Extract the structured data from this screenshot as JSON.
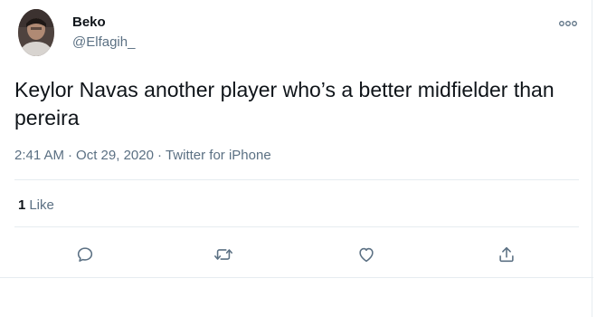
{
  "tweet": {
    "author": {
      "name": "Beko",
      "handle": "@Elfagih_"
    },
    "text": "Keylor Navas another player who’s a better midfielder than pereira",
    "time": "2:41 AM",
    "date": "Oct 29, 2020",
    "source": "Twitter for iPhone",
    "separator": "·",
    "likes": {
      "count": "1",
      "label": "Like"
    }
  },
  "icons": {
    "more": "more-horizontal-icon",
    "reply": "reply-icon",
    "retweet": "retweet-icon",
    "like": "heart-icon",
    "share": "share-icon"
  },
  "colors": {
    "text": "#0f1419",
    "secondary": "#5b7083",
    "divider": "#e6ecf0"
  }
}
